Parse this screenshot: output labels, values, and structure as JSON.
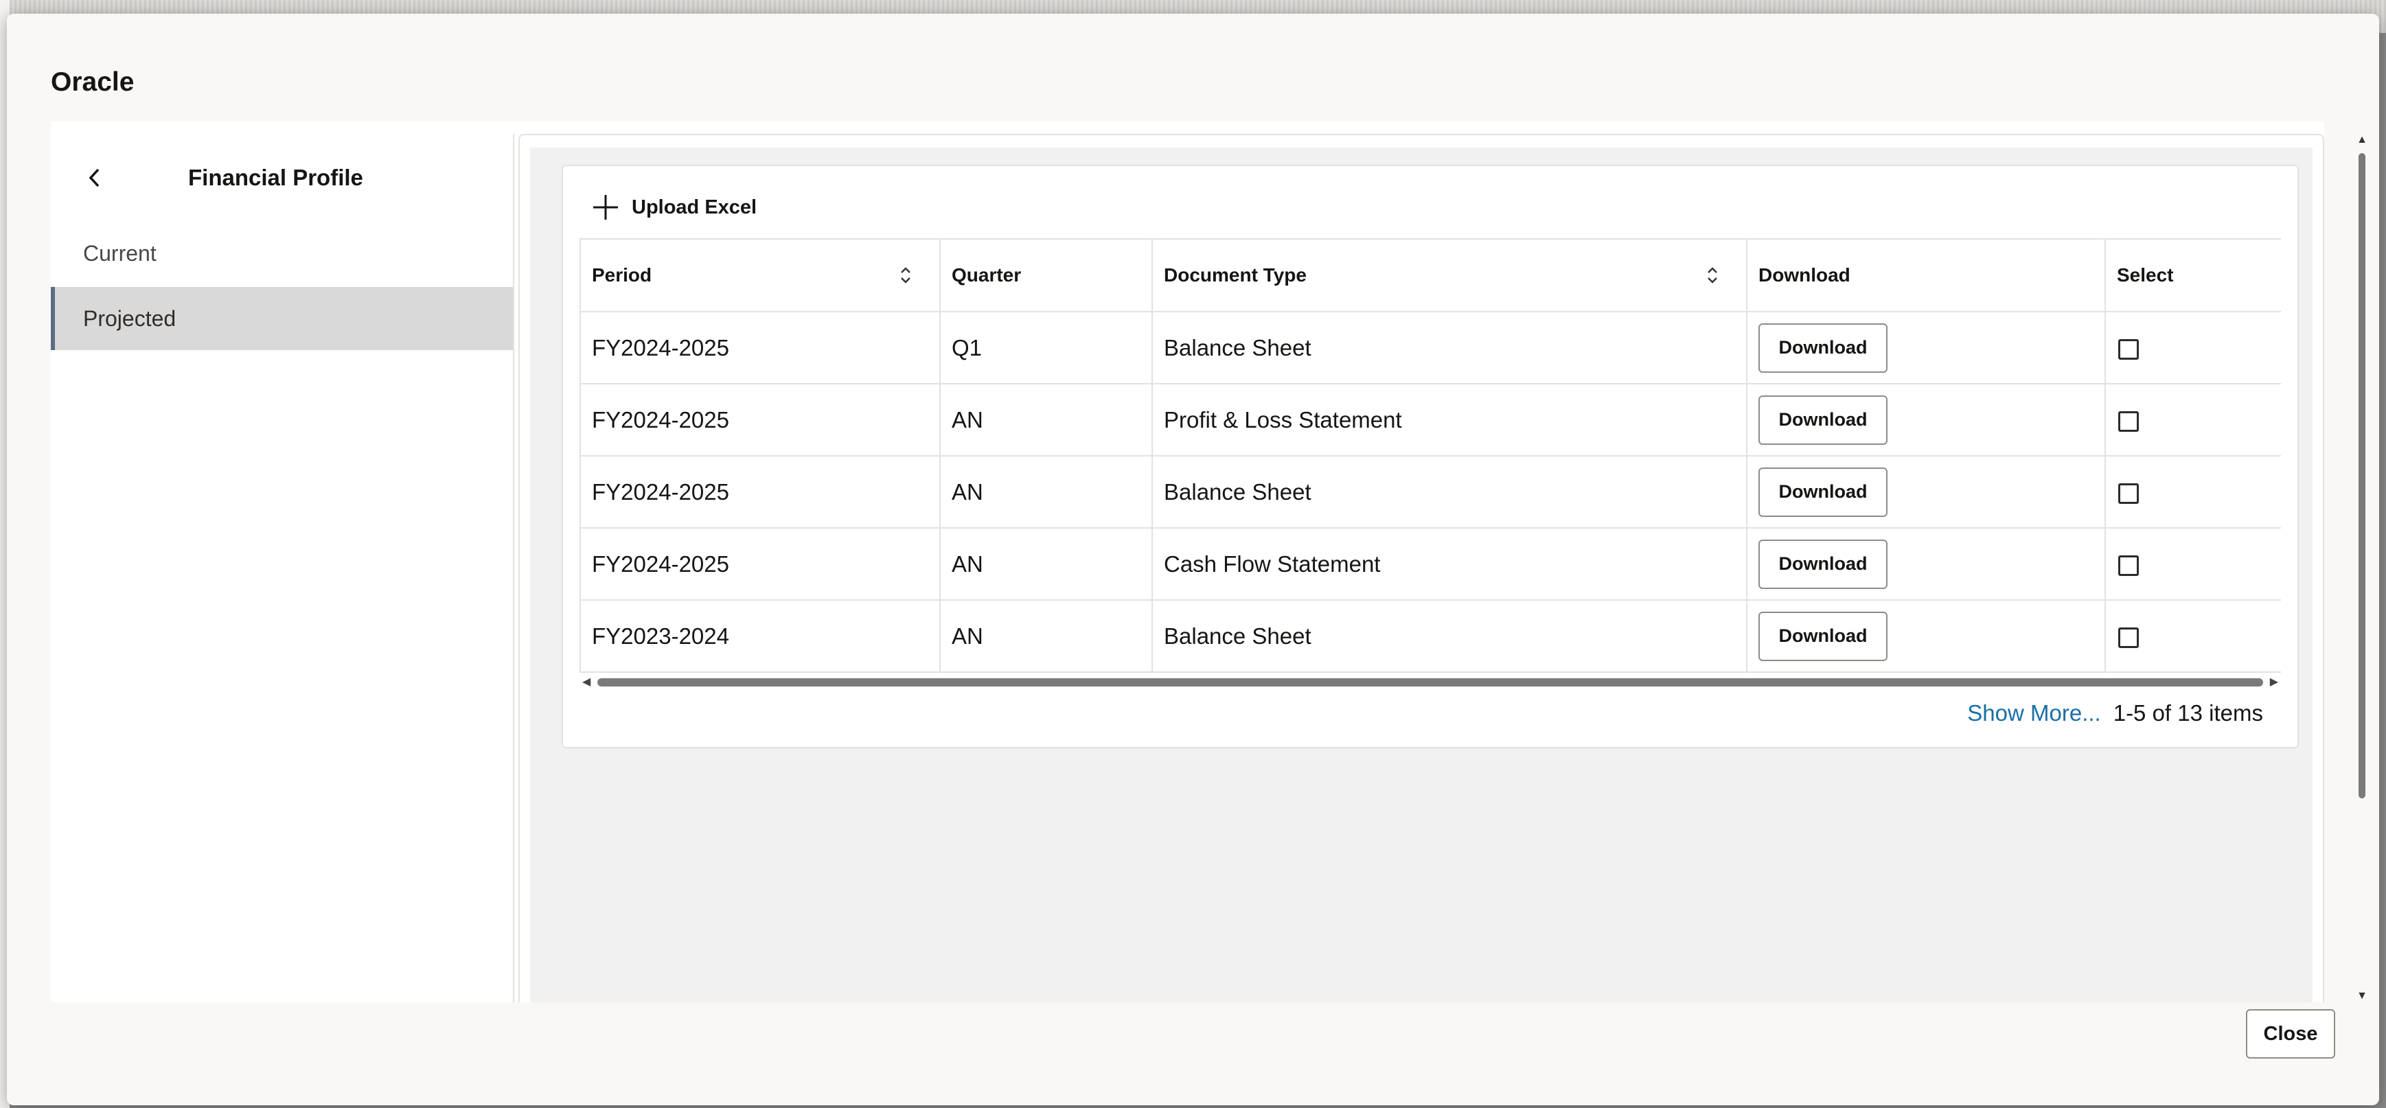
{
  "dialog": {
    "title": "Oracle",
    "close_label": "Close"
  },
  "sidenav": {
    "title": "Financial Profile",
    "back_icon": "chevron-left-icon",
    "items": [
      {
        "label": "Current",
        "selected": false
      },
      {
        "label": "Projected",
        "selected": true
      }
    ]
  },
  "toolbar": {
    "upload_label": "Upload Excel",
    "upload_icon": "plus-icon"
  },
  "table": {
    "columns": [
      "Period",
      "Quarter",
      "Document Type",
      "Download",
      "Select"
    ],
    "rows": [
      {
        "period": "FY2024-2025",
        "quarter": "Q1",
        "doc_type": "Balance Sheet",
        "download": "Download",
        "selected": false
      },
      {
        "period": "FY2024-2025",
        "quarter": "AN",
        "doc_type": "Profit & Loss Statement",
        "download": "Download",
        "selected": false
      },
      {
        "period": "FY2024-2025",
        "quarter": "AN",
        "doc_type": "Balance Sheet",
        "download": "Download",
        "selected": false
      },
      {
        "period": "FY2024-2025",
        "quarter": "AN",
        "doc_type": "Cash Flow Statement",
        "download": "Download",
        "selected": false
      },
      {
        "period": "FY2023-2024",
        "quarter": "AN",
        "doc_type": "Balance Sheet",
        "download": "Download",
        "selected": false
      }
    ]
  },
  "pager": {
    "show_more": "Show More...",
    "count": "1-5 of 13 items"
  },
  "colors": {
    "link": "#1a6fa8",
    "selected_bg": "#d9d9d9",
    "selected_border": "#5a6b85"
  }
}
